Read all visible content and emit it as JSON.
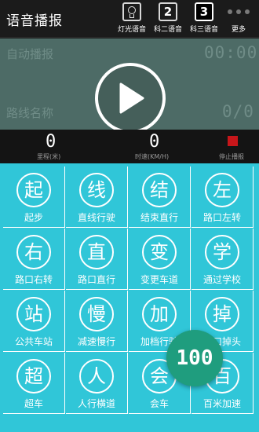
{
  "header": {
    "title": "语音播报",
    "modes": [
      {
        "glyph": "",
        "label": "灯光语音",
        "icon": "lightbulb-icon"
      },
      {
        "glyph": "2",
        "label": "科二语音"
      },
      {
        "glyph": "3",
        "label": "科三语音",
        "active": true
      },
      {
        "glyph": "",
        "label": "更多",
        "icon": "more-dots-icon"
      }
    ]
  },
  "display": {
    "auto_label": "自动播报",
    "timer": "00:00",
    "route_label": "路线名称",
    "route_progress": "0/0",
    "play_icon": "play-icon"
  },
  "stats": {
    "distance_value": "0",
    "distance_label": "里程(米)",
    "speed_value": "0",
    "speed_label": "时速(KM/H)",
    "stop_label": "停止播报",
    "stop_color": "#c7161a"
  },
  "grid": [
    {
      "char": "起",
      "label": "起步"
    },
    {
      "char": "线",
      "label": "直线行驶"
    },
    {
      "char": "结",
      "label": "结束直行"
    },
    {
      "char": "左",
      "label": "路口左转"
    },
    {
      "char": "右",
      "label": "路口右转"
    },
    {
      "char": "直",
      "label": "路口直行"
    },
    {
      "char": "变",
      "label": "变更车道"
    },
    {
      "char": "学",
      "label": "通过学校"
    },
    {
      "char": "站",
      "label": "公共车站"
    },
    {
      "char": "慢",
      "label": "减速慢行"
    },
    {
      "char": "加",
      "label": "加档行驶"
    },
    {
      "char": "掉",
      "label": "路口掉头"
    },
    {
      "char": "超",
      "label": "超车"
    },
    {
      "char": "人",
      "label": "人行横道"
    },
    {
      "char": "会",
      "label": "会车"
    },
    {
      "char": "百",
      "label": "百米加速"
    }
  ],
  "badge": {
    "value": "100",
    "color": "#1f9d7e"
  },
  "colors": {
    "accent": "#30c6d8",
    "display_bg": "#4d6b66",
    "header_bg": "#1b1b1b"
  }
}
